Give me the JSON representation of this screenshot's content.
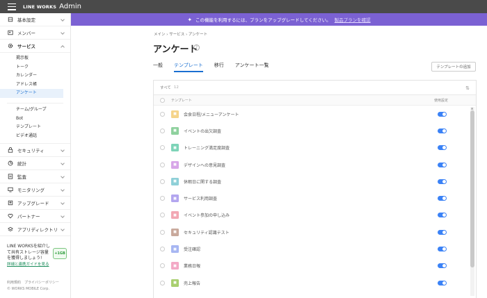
{
  "topbar": {
    "brand": "LINE WORKS",
    "title": "Admin"
  },
  "sidebar": {
    "items_top": [
      {
        "name": "sidebar-item-basic-settings",
        "label": "基本設定",
        "icon": "building-icon"
      },
      {
        "name": "sidebar-item-members",
        "label": "メンバー",
        "icon": "person-icon"
      }
    ],
    "service": {
      "label": "サービス",
      "icon": "gear-icon"
    },
    "service_sub1": [
      "掲示板",
      "トーク",
      "カレンダー",
      "アドレス帳",
      "アンケート"
    ],
    "service_sub2": [
      "チーム/グループ",
      "Bot",
      "テンプレート",
      "ビデオ通話"
    ],
    "items_bottom": [
      {
        "name": "sidebar-item-security",
        "label": "セキュリティ",
        "icon": "lock-icon"
      },
      {
        "name": "sidebar-item-statistics",
        "label": "統計",
        "icon": "chart-icon"
      },
      {
        "name": "sidebar-item-audit",
        "label": "監査",
        "icon": "audit-icon"
      },
      {
        "name": "sidebar-item-monitoring",
        "label": "モニタリング",
        "icon": "monitor-icon"
      },
      {
        "name": "sidebar-item-upgrade",
        "label": "アップグレード",
        "icon": "upgrade-icon"
      },
      {
        "name": "sidebar-item-partner",
        "label": "パートナー",
        "icon": "heart-icon"
      },
      {
        "name": "sidebar-item-app-directory",
        "label": "アプリディレクトリ",
        "icon": "layers-icon"
      }
    ],
    "promo": {
      "line1": "LINE WORKSを紹介し",
      "line2": "て共有ストレージ容量",
      "line3": "を獲得しましょう!",
      "link": "詳細と連携ガイドを見る",
      "badge": "+1GB"
    },
    "footer": {
      "links": "利用規約　プライバシーポリシー",
      "copyright": "© WORKS MOBILE Corp."
    }
  },
  "banner": {
    "text": "この機能を利用するには、プランをアップグレードしてください。",
    "link": "製品プランを確認"
  },
  "main": {
    "breadcrumb": "メイン  ›  サービス  ›  アンケート",
    "title": "アンケート",
    "help": "?",
    "tabs": [
      "一般",
      "テンプレート",
      "移行",
      "アンケート一覧"
    ],
    "active_tab": 1,
    "add_button": "テンプレートの追加",
    "filter": "すべて",
    "filter_count": "12",
    "sort_icon": "sort-icon",
    "columns": {
      "name": "テンプレート",
      "use": "使用設定"
    },
    "templates": [
      {
        "label": "会食日程/メニューアンケート",
        "color": "#f5d48a",
        "on": true
      },
      {
        "label": "イベントの出欠調査",
        "color": "#8fd19e",
        "on": true
      },
      {
        "label": "トレーニング満足度調査",
        "color": "#7ed4b8",
        "on": true
      },
      {
        "label": "デザインへの意見調査",
        "color": "#d7a6e8",
        "on": true
      },
      {
        "label": "休暇日に関する調査",
        "color": "#8fd0d8",
        "on": true
      },
      {
        "label": "サービス利用調査",
        "color": "#b3a6ef",
        "on": true
      },
      {
        "label": "イベント参加の申し込み",
        "color": "#f2a7b3",
        "on": true
      },
      {
        "label": "セキュリティ認識テスト",
        "color": "#c9a99c",
        "on": true
      },
      {
        "label": "受注確認",
        "color": "#a7b6f2",
        "on": true
      },
      {
        "label": "業務日報",
        "color": "#f3a9c6",
        "on": true
      },
      {
        "label": "売上報告",
        "color": "#a9cf6f",
        "on": true
      }
    ]
  }
}
